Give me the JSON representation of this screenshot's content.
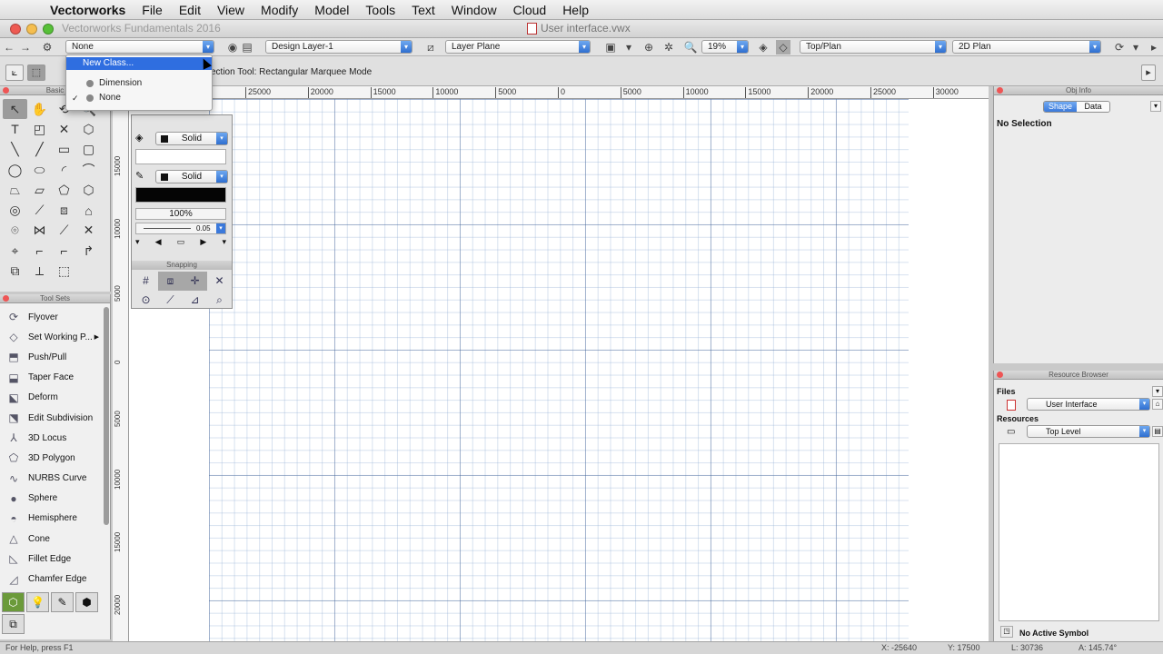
{
  "menubar": {
    "apple": "",
    "items": [
      "Vectorworks",
      "File",
      "Edit",
      "View",
      "Modify",
      "Model",
      "Tools",
      "Text",
      "Window",
      "Cloud",
      "Help"
    ]
  },
  "titlebar": {
    "app_title": "Vectorworks Fundamentals 2016",
    "doc_title": "User interface.vwx"
  },
  "viewbar": {
    "class_value": "None",
    "layer_value": "Design Layer-1",
    "plane_value": "Layer Plane",
    "zoom_value": "19%",
    "view_value": "Top/Plan",
    "render_value": "2D Plan"
  },
  "modebar": {
    "mode_text": "ection Tool: Rectangular Marquee Mode"
  },
  "class_dropdown": {
    "new_class": "New Class...",
    "items": [
      {
        "label": "Dimension",
        "checked": false
      },
      {
        "label": "None",
        "checked": true
      }
    ]
  },
  "basic_palette": {
    "title": "Basic",
    "tools": [
      "↖",
      "✋",
      "⟲",
      "🔍",
      "T",
      "◰",
      "✕",
      "⬡",
      "╲",
      "╱",
      "▭",
      "▢",
      "◯",
      "⬭",
      "◜",
      "⌒",
      "⏢",
      "⏥",
      "⬠",
      "⬡",
      "◎",
      "⟋",
      "⧈",
      "⌂",
      "⌾",
      "⋈",
      "⟋",
      "✕",
      "⌖",
      "⌐",
      "⌐",
      "↱",
      "⧉",
      "⟂",
      "⬚",
      ""
    ]
  },
  "toolsets": {
    "title": "Tool Sets",
    "items": [
      {
        "label": "Flyover",
        "icon": "⟳"
      },
      {
        "label": "Set Working P...",
        "icon": "◇"
      },
      {
        "label": "Push/Pull",
        "icon": "⬒"
      },
      {
        "label": "Taper Face",
        "icon": "⬓"
      },
      {
        "label": "Deform",
        "icon": "⬕"
      },
      {
        "label": "Edit Subdivision",
        "icon": "⬔"
      },
      {
        "label": "3D Locus",
        "icon": "⅄"
      },
      {
        "label": "3D Polygon",
        "icon": "⬠"
      },
      {
        "label": "NURBS Curve",
        "icon": "∿"
      },
      {
        "label": "Sphere",
        "icon": "●"
      },
      {
        "label": "Hemisphere",
        "icon": "◓"
      },
      {
        "label": "Cone",
        "icon": "△"
      },
      {
        "label": "Fillet Edge",
        "icon": "◺"
      },
      {
        "label": "Chamfer Edge",
        "icon": "◿"
      }
    ]
  },
  "rulers": {
    "horizontal": [
      "25000",
      "20000",
      "15000",
      "10000",
      "5000",
      "0",
      "5000",
      "10000",
      "15000",
      "20000",
      "25000",
      "30000"
    ],
    "vertical": [
      "15000",
      "10000",
      "5000",
      "0",
      "5000",
      "10000",
      "15000",
      "20000"
    ]
  },
  "attributes": {
    "fill_style": "Solid",
    "pen_style": "Solid",
    "opacity": "100%",
    "line_weight": "0.05",
    "snapping_title": "Snapping"
  },
  "objinfo": {
    "title": "Obj Info",
    "tab_shape": "Shape",
    "tab_data": "Data",
    "selection": "No Selection"
  },
  "resource_browser": {
    "title": "Resource Browser",
    "files_label": "Files",
    "files_value": "User Interface",
    "resources_label": "Resources",
    "resources_value": "Top Level",
    "active_symbol": "No Active Symbol"
  },
  "statusbar": {
    "help": "For Help, press F1",
    "x": "X: -25640",
    "y": "Y: 17500",
    "l": "L: 30736",
    "a": "A: 145.74°"
  },
  "colors": {
    "accent": "#2f6ee0",
    "close": "#ee5a52",
    "minimize": "#f5be4f",
    "zoom": "#57c038"
  }
}
